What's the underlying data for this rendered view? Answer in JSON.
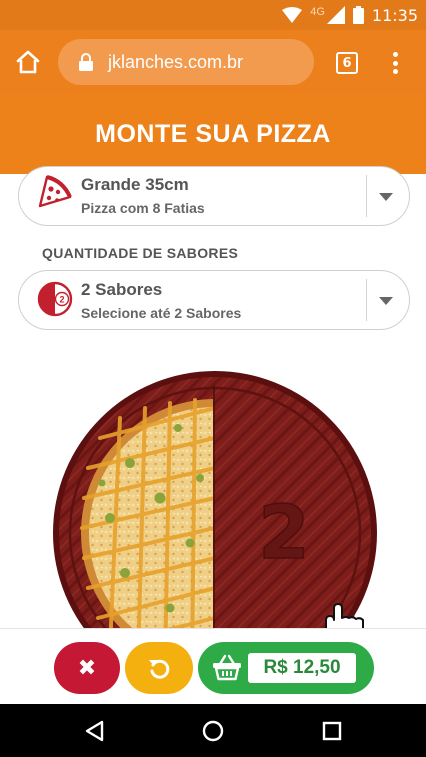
{
  "status_bar": {
    "network": "4G",
    "time": "11:35"
  },
  "browser": {
    "url": "jklanches.com.br",
    "tab_count": "6"
  },
  "header": {
    "title": "MONTE SUA PIZZA"
  },
  "size_select": {
    "title": "Grande 35cm",
    "subtitle": "Pizza com 8 Fatias",
    "icon": "pizza-slice-icon"
  },
  "flavors_section": {
    "label": "QUANTIDADE DE SABORES"
  },
  "flavors_select": {
    "title": "2 Sabores",
    "subtitle": "Selecione até 2 Sabores",
    "icon_number": "2"
  },
  "pizza": {
    "empty_half_number": "2"
  },
  "bottom_bar": {
    "cancel_symbol": "✖",
    "price": "R$ 12,50"
  },
  "colors": {
    "brand_orange": "#ed811a",
    "cancel_red": "#c41834",
    "reset_yellow": "#f4b00f",
    "cart_green": "#2eaa46"
  }
}
